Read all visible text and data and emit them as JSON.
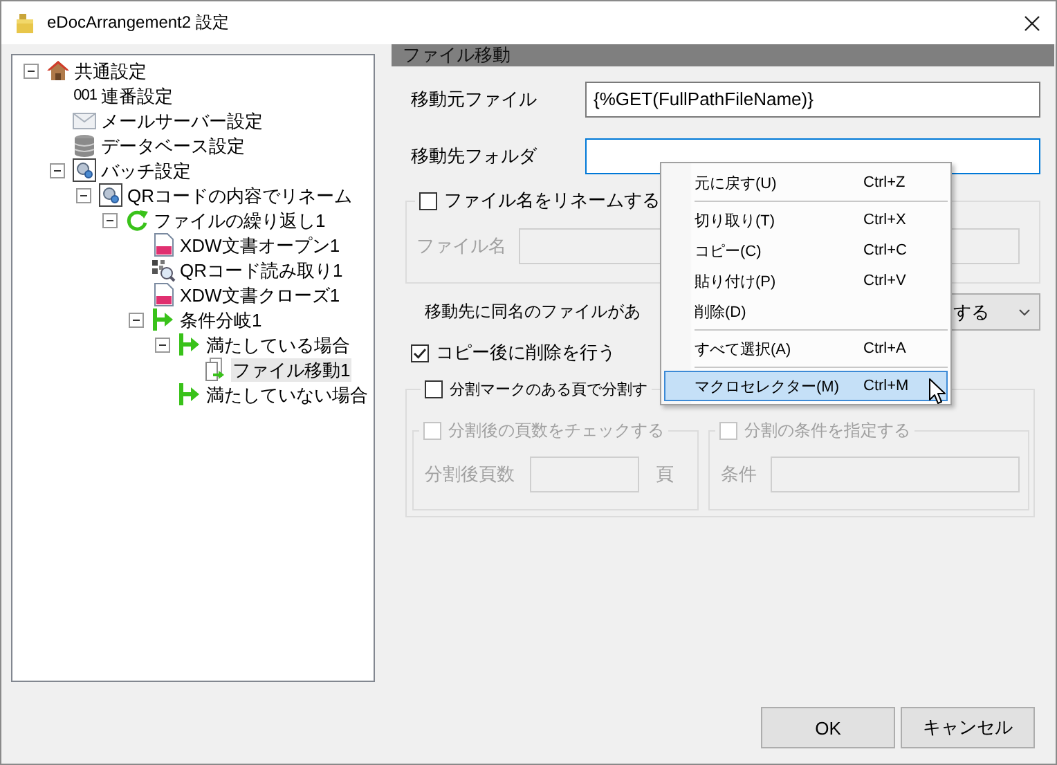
{
  "window": {
    "title": "eDocArrangement2 設定"
  },
  "tree": [
    {
      "label": "共通設定",
      "kind": "house",
      "expanded": true,
      "selected": false,
      "children": [
        {
          "label": "連番設定",
          "kind": "number",
          "icon_text": "001",
          "selected": false
        },
        {
          "label": "メールサーバー設定",
          "kind": "envelope",
          "selected": false
        },
        {
          "label": "データベース設定",
          "kind": "database",
          "selected": false
        },
        {
          "label": "バッチ設定",
          "kind": "batch",
          "expanded": true,
          "selected": false,
          "children": [
            {
              "label": "QRコードの内容でリネーム",
              "kind": "batch",
              "expanded": true,
              "selected": false,
              "children": [
                {
                  "label": "ファイルの繰り返し1",
                  "kind": "loop",
                  "expanded": true,
                  "selected": false,
                  "children": [
                    {
                      "label": "XDW文書オープン1",
                      "kind": "xdw",
                      "selected": false
                    },
                    {
                      "label": "QRコード読み取り1",
                      "kind": "qr",
                      "selected": false
                    },
                    {
                      "label": "XDW文書クローズ1",
                      "kind": "xdw",
                      "selected": false
                    },
                    {
                      "label": "条件分岐1",
                      "kind": "branch",
                      "expanded": true,
                      "selected": false,
                      "children": [
                        {
                          "label": "満たしている場合",
                          "kind": "branch",
                          "expanded": true,
                          "selected": false,
                          "children": [
                            {
                              "label": "ファイル移動1",
                              "kind": "filemove",
                              "selected": true
                            }
                          ]
                        },
                        {
                          "label": "満たしていない場合",
                          "kind": "branch",
                          "selected": false
                        }
                      ]
                    }
                  ]
                }
              ]
            }
          ]
        }
      ]
    }
  ],
  "panel": {
    "title": "ファイル移動",
    "fields": [
      {
        "label": "移動元ファイル",
        "value": "{%GET(FullPathFileName)}",
        "focused": false
      },
      {
        "label": "移動先フォルダ",
        "focused": true
      }
    ],
    "rename_group": {
      "label": "ファイル名をリネームする",
      "checked": false,
      "field_label": "ファイル名"
    },
    "conflict": {
      "label": "移動先に同名のファイルがあ",
      "value": "する"
    },
    "delete_after_copy": {
      "label": "コピー後に削除を行う",
      "checked": true
    },
    "split_group": {
      "label": "分割マークのある頁で分割す",
      "checked": false,
      "subgroups": [
        {
          "label": "分割後の頁数をチェックする",
          "checked": false,
          "field_label": "分割後頁数",
          "unit": "頁"
        },
        {
          "label": "分割の条件を指定する",
          "checked": false,
          "field_label": "条件"
        }
      ]
    }
  },
  "buttons": [
    {
      "label": "OK"
    },
    {
      "label": "キャンセル"
    }
  ],
  "context_menu": {
    "items": [
      {
        "kind": "item",
        "label": "元に戻す(U)",
        "shortcut": "Ctrl+Z",
        "selected": false
      },
      {
        "kind": "separator"
      },
      {
        "kind": "item",
        "label": "切り取り(T)",
        "shortcut": "Ctrl+X",
        "selected": false
      },
      {
        "kind": "item",
        "label": "コピー(C)",
        "shortcut": "Ctrl+C",
        "selected": false
      },
      {
        "kind": "item",
        "label": "貼り付け(P)",
        "shortcut": "Ctrl+V",
        "selected": false
      },
      {
        "kind": "item",
        "label": "削除(D)",
        "selected": false
      },
      {
        "kind": "separator"
      },
      {
        "kind": "item",
        "label": "すべて選択(A)",
        "shortcut": "Ctrl+A",
        "selected": false
      },
      {
        "kind": "separator"
      },
      {
        "kind": "item",
        "label": "マクロセレクター(M)",
        "shortcut": "Ctrl+M",
        "selected": true
      }
    ]
  }
}
